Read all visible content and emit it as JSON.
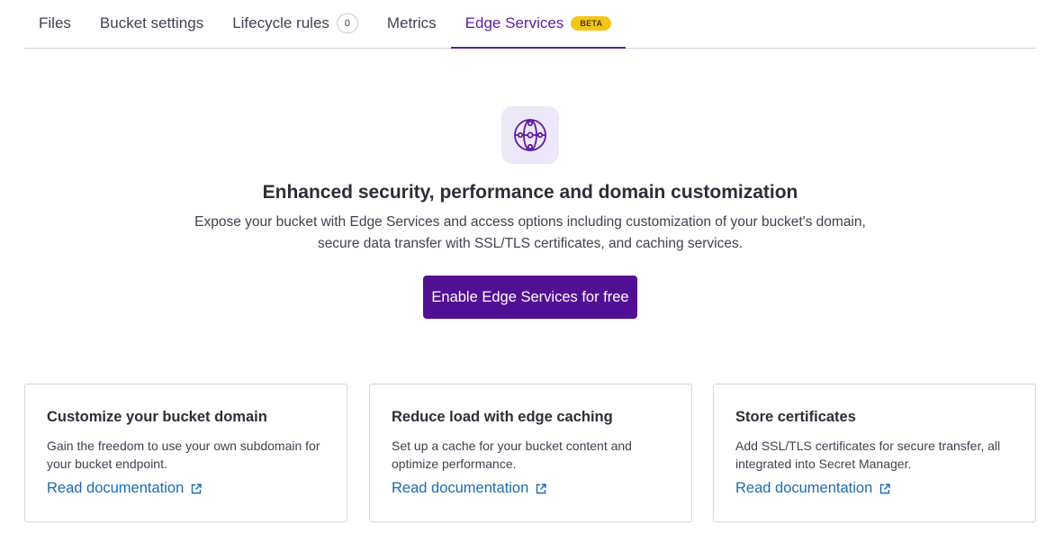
{
  "tabs": [
    {
      "label": "Files"
    },
    {
      "label": "Bucket settings"
    },
    {
      "label": "Lifecycle rules",
      "count": "0"
    },
    {
      "label": "Metrics"
    },
    {
      "label": "Edge Services",
      "badge": "BETA",
      "active": true
    }
  ],
  "colors": {
    "accent": "#5e1aa3",
    "button": "#521094",
    "beta_badge": "#f5c518",
    "link": "#1a6bb0",
    "icon_bg": "#ede8f8"
  },
  "hero": {
    "icon": "globe-network-icon",
    "title": "Enhanced security, performance and domain customization",
    "description_line1": "Expose your bucket with Edge Services and access options including customization of your bucket's domain,",
    "description_line2": "secure data transfer with SSL/TLS certificates, and caching services.",
    "cta_label": "Enable Edge Services for free"
  },
  "cards": [
    {
      "title": "Customize your bucket domain",
      "description": "Gain the freedom to use your own subdomain for your bucket endpoint.",
      "link": "Read documentation",
      "link_icon": "external-link-icon"
    },
    {
      "title": "Reduce load with edge caching",
      "description": "Set up a cache for your bucket content and optimize performance.",
      "link": "Read documentation",
      "link_icon": "external-link-icon"
    },
    {
      "title": "Store certificates",
      "description": "Add SSL/TLS certificates for secure transfer, all integrated into Secret Manager.",
      "link": "Read documentation",
      "link_icon": "external-link-icon"
    }
  ]
}
